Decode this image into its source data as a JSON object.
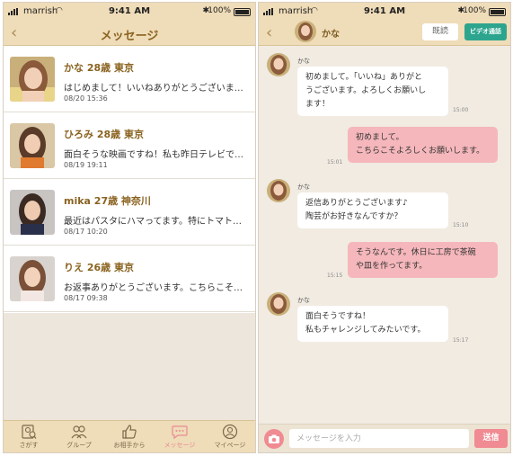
{
  "status": {
    "carrier": "marrish",
    "time": "9:41 AM",
    "battery": "100%"
  },
  "messages_screen": {
    "title": "メッセージ",
    "conversations": [
      {
        "name": "かな 28歳 東京",
        "preview": "はじめまして！いいねありがとうございます！よろしくお願いします",
        "date": "08/20 15:36"
      },
      {
        "name": "ひろみ 28歳 東京",
        "preview": "面白そうな映画ですね！私も昨日テレビで見ました",
        "date": "08/19 19:11"
      },
      {
        "name": "mika 27歳 神奈川",
        "preview": "最近はパスタにハマってます。特にトマトソースが好き",
        "date": "08/17 10:20"
      },
      {
        "name": "りえ 26歳 東京",
        "preview": "お返事ありがとうございます。こちらこそよろしくお願いします",
        "date": "08/17 09:38"
      }
    ],
    "tabs": [
      {
        "label": "さがす",
        "icon": "search-profile-icon"
      },
      {
        "label": "グループ",
        "icon": "group-icon"
      },
      {
        "label": "お相手から",
        "icon": "thumbs-up-icon"
      },
      {
        "label": "メッセージ",
        "icon": "speech-bubble-icon"
      },
      {
        "label": "マイページ",
        "icon": "person-icon"
      }
    ],
    "active_tab": "メッセージ"
  },
  "chat_screen": {
    "partner_name": "かな",
    "read_label": "既読",
    "video_label": "ビデオ通話",
    "messages": [
      {
        "from": "in",
        "sender": "かな",
        "lines": [
          "初めまして。「いいね」ありがと",
          "うございます。よろしくお願いし",
          "ます！"
        ],
        "time": "15:00"
      },
      {
        "from": "out",
        "lines": [
          "初めまして。",
          "こちらこそよろしくお願いします。"
        ],
        "time": "15:01"
      },
      {
        "from": "in",
        "sender": "かな",
        "lines": [
          "返信ありがとうございます♪",
          "陶芸がお好きなんですか？"
        ],
        "time": "15:10"
      },
      {
        "from": "out",
        "lines": [
          "そうなんです。休日に工房で茶碗",
          "や皿を作ってます。"
        ],
        "time": "15:15"
      },
      {
        "from": "in",
        "sender": "かな",
        "lines": [
          "面白そうですね！",
          "私もチャレンジしてみたいです。"
        ],
        "time": "15:17"
      }
    ],
    "input_placeholder": "メッセージを入力",
    "send_label": "送信"
  },
  "colors": {
    "header_bg": "#efdcb8",
    "title_brown": "#8a6320",
    "outgoing_bubble": "#f5b7bb",
    "video_button": "#2da58e",
    "send_button": "#f08a93"
  }
}
